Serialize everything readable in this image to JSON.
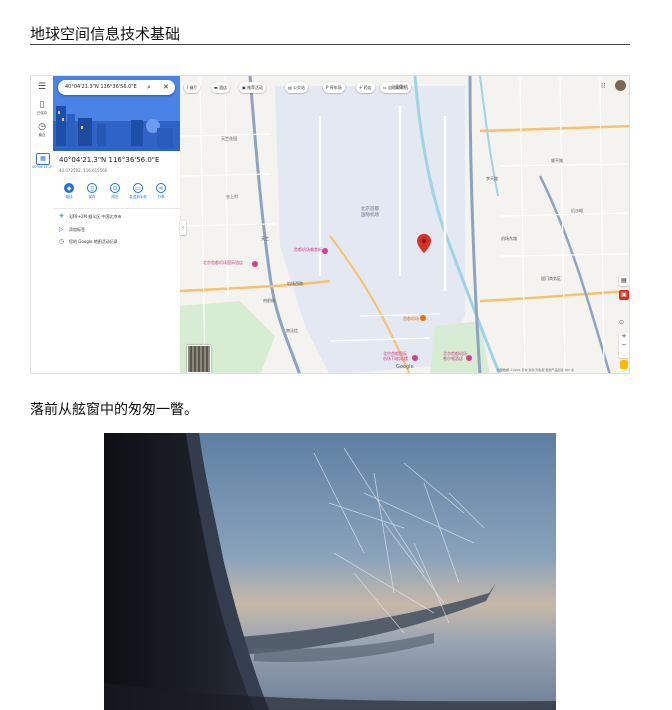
{
  "header": {
    "title": "地球空间信息技术基础"
  },
  "map": {
    "rail": {
      "menu_icon": "menu-icon",
      "saved_label": "已保存",
      "recents_label": "最近",
      "recent_place_label": "40°04′21.3\"N..."
    },
    "search": {
      "query": "40°04'21.3\"N 116°36'56.0\"E"
    },
    "place": {
      "title": "40°04'21.3\"N 116°36'56.0\"E",
      "decimal": "40.072582, 116.615566",
      "actions": [
        "路线",
        "保存",
        "附近",
        "发送到手机",
        "分享"
      ],
      "plus_code": "3JF8+2M 顺义区 中国北京市",
      "add_label": "添加标签",
      "activity": "您的 Google 地图活动记录"
    },
    "chips": [
      "餐厅",
      "酒店",
      "推荐活动",
      "公交站",
      "停车场",
      "药店",
      "自动取款机"
    ],
    "labels": {
      "airport": "北京首都\n国际机场",
      "poi_pink_1": "首都机场美食街",
      "poi_pink_2": "北京首都机场国际酒店",
      "poi_orange": "首都机场",
      "poi_pink_3": "北京首都国际\n机场T3航站楼",
      "poi_pink_4": "北京首都机场\n希尔顿酒店",
      "google": "Google",
      "roads": [
        "仓上村",
        "天竺",
        "机场西路",
        "李天路",
        "顺平路",
        "机场东路",
        "南法信",
        "后沙峪",
        "国门商务区",
        "府前街",
        "天竺花园",
        "十里堡村"
      ]
    },
    "footer": "地图数据 ©2024   日本   条款   隐私权   发送产品反馈   200 米"
  },
  "caption": "落前从舷窗中的匆匆一瞥。",
  "colors": {
    "accent": "#1a73e8",
    "water_airport": "#dfe5f0",
    "pin": "#d93025"
  }
}
